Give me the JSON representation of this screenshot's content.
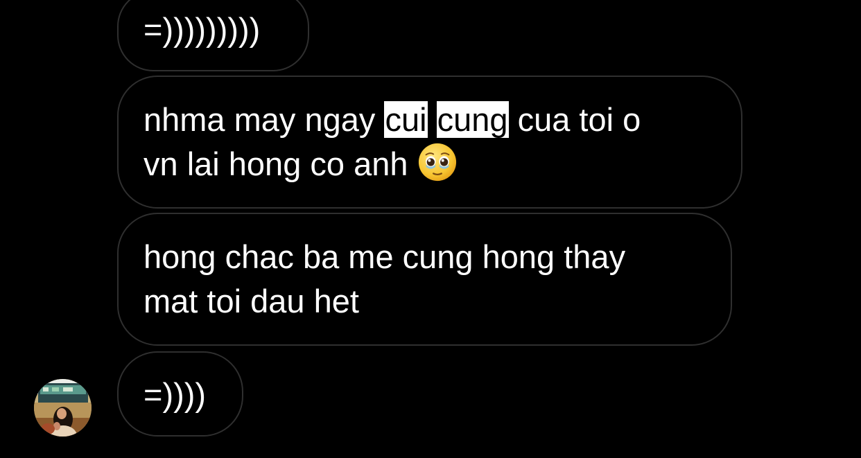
{
  "conversation": {
    "messages": [
      {
        "text": "=)))))))))"
      },
      {
        "before": "nhma may ngay ",
        "highlight_1": "cui",
        "space": " ",
        "highlight_2": "cung",
        "line1_after": " cua toi o",
        "line2": "vn lai hong co anh ",
        "emoji": "face-holding-back-tears"
      },
      {
        "line1": "hong chac ba me cung hong thay",
        "line2": "mat toi dau het"
      },
      {
        "text": "=))))"
      }
    ],
    "sender": {
      "avatar_icon": "profile-photo"
    }
  },
  "colors": {
    "background": "#000000",
    "bubble_border": "#2f2f2f",
    "text": "#ffffff",
    "highlight_bg": "#ffffff",
    "highlight_text": "#000000"
  }
}
